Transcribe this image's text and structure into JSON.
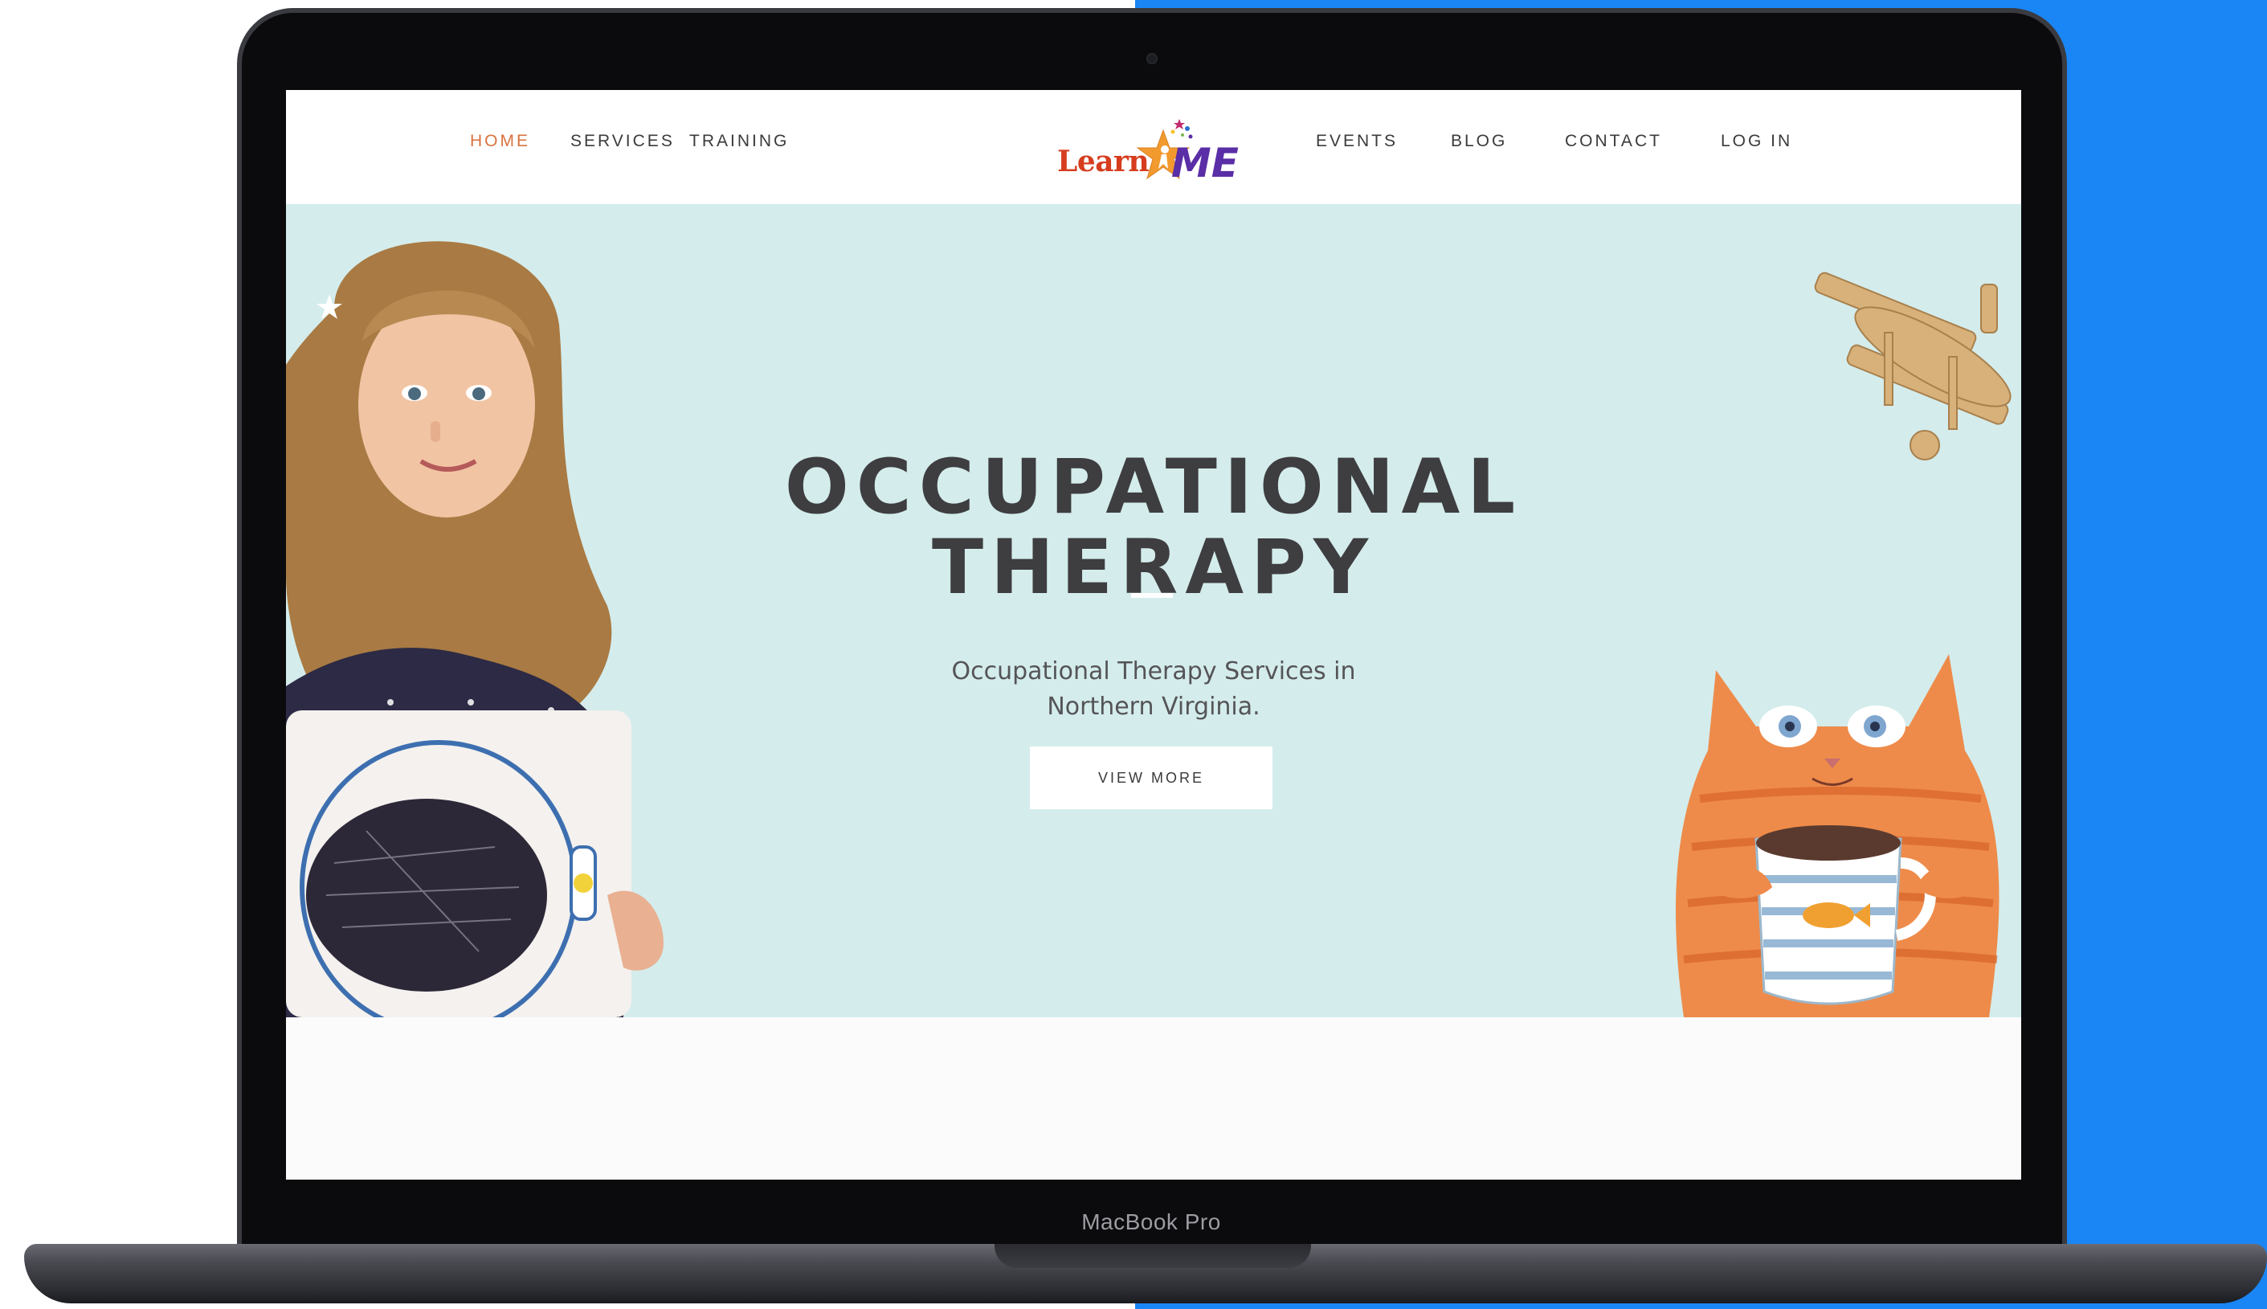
{
  "device": {
    "label": "MacBook Pro"
  },
  "nav": {
    "items": [
      {
        "label": "HOME",
        "active": true
      },
      {
        "label": "SERVICES",
        "active": false
      },
      {
        "label": "TRAINING",
        "active": false
      },
      {
        "label": "EVENTS",
        "active": false
      },
      {
        "label": "BLOG",
        "active": false
      },
      {
        "label": "CONTACT",
        "active": false
      },
      {
        "label": "LOG IN",
        "active": false
      }
    ],
    "active_color": "#d9733f"
  },
  "logo": {
    "text_left": "Learn",
    "text_right": "ME",
    "colors": {
      "learn": "#d63d1e",
      "star": "#f29a2e",
      "me": "#5a2ea6"
    }
  },
  "hero": {
    "title_line1": "OCCUPATIONAL",
    "title_line2": "THERAPY",
    "subtitle_line1": "Occupational Therapy Services in",
    "subtitle_line2": "Northern Virginia.",
    "button_label": "VIEW MORE",
    "background_color": "#d4ecec"
  },
  "colors": {
    "accent_blue": "#1a86f5"
  }
}
